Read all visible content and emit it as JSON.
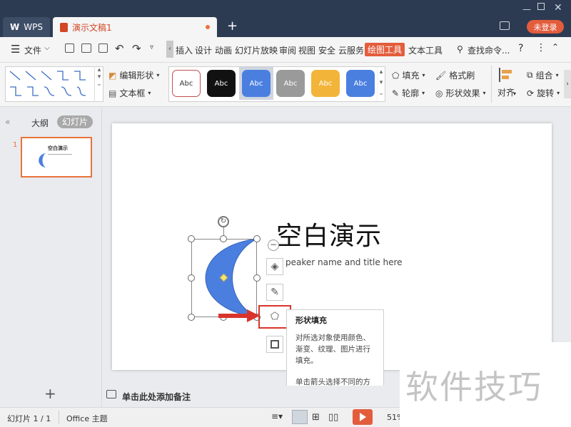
{
  "titlebar": {
    "wps_tab": "WPS",
    "doc_tab": "演示文稿1",
    "login": "未登录"
  },
  "menubar": {
    "file": "文件",
    "items": [
      "插入",
      "设计",
      "动画",
      "幻灯片放映",
      "审阅",
      "视图",
      "安全",
      "云服务"
    ],
    "active": "绘图工具",
    "text_tools": "文本工具",
    "search": "查找命令..."
  },
  "ribbon": {
    "edit_shape": "编辑形状",
    "textbox": "文本框",
    "style_label": "Abc",
    "fill": "填充",
    "format_painter": "格式刷",
    "outline": "轮廓",
    "shape_effect": "形状效果",
    "align": "对齐",
    "group": "组合",
    "rotate": "旋转"
  },
  "panel": {
    "outline_tab": "大纲",
    "slides_tab": "幻灯片",
    "slide_number": "1",
    "thumb_title": "空白演示"
  },
  "slide": {
    "title": "空白演示",
    "subtitle": "peaker name and title here"
  },
  "notes": {
    "placeholder": "单击此处添加备注"
  },
  "tooltip": {
    "title": "形状填充",
    "desc": "对所选对象使用颜色、渐变、纹理、图片进行填充。",
    "hint": "单击箭头选择不同的方式进行填充。"
  },
  "statusbar": {
    "slide_info": "幻灯片 1 / 1",
    "theme": "Office 主题",
    "zoom": "51%"
  },
  "watermark": {
    "text": "软件技巧"
  },
  "colors": {
    "titlebar": "#2d3b52",
    "accent": "#e35d3d",
    "shape_fill": "#4a7fe0",
    "selection": "#e8733b"
  }
}
